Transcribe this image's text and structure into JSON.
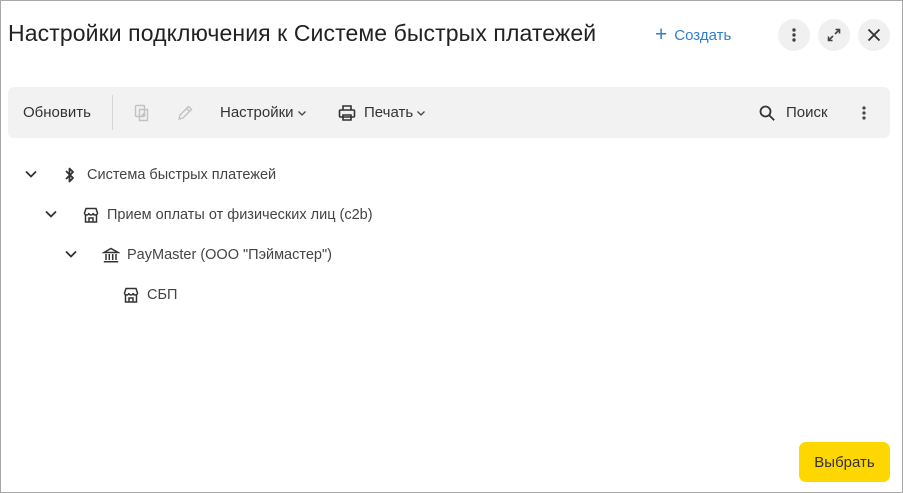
{
  "window": {
    "title": "Настройки подключения к Системе быстрых платежей",
    "create_label": "Создать"
  },
  "toolbar": {
    "refresh_label": "Обновить",
    "settings_label": "Настройки",
    "print_label": "Печать",
    "search_label": "Поиск"
  },
  "tree": {
    "nodes": [
      {
        "label": "Система быстрых платежей",
        "icon": "bluetooth-icon",
        "level": 0,
        "expanded": true
      },
      {
        "label": "Прием оплаты от физических лиц (c2b)",
        "icon": "store-icon",
        "level": 1,
        "expanded": true
      },
      {
        "label": "PayMaster (ООО \"Пэймастер\")",
        "icon": "bank-icon",
        "level": 2,
        "expanded": true
      },
      {
        "label": "СБП",
        "icon": "store-icon",
        "level": 3,
        "expanded": false
      }
    ]
  },
  "footer": {
    "select_label": "Выбрать"
  },
  "colors": {
    "accent": "#2f7fd1",
    "primary_button": "#ffd700",
    "toolbar_bg": "#f2f2f2"
  }
}
